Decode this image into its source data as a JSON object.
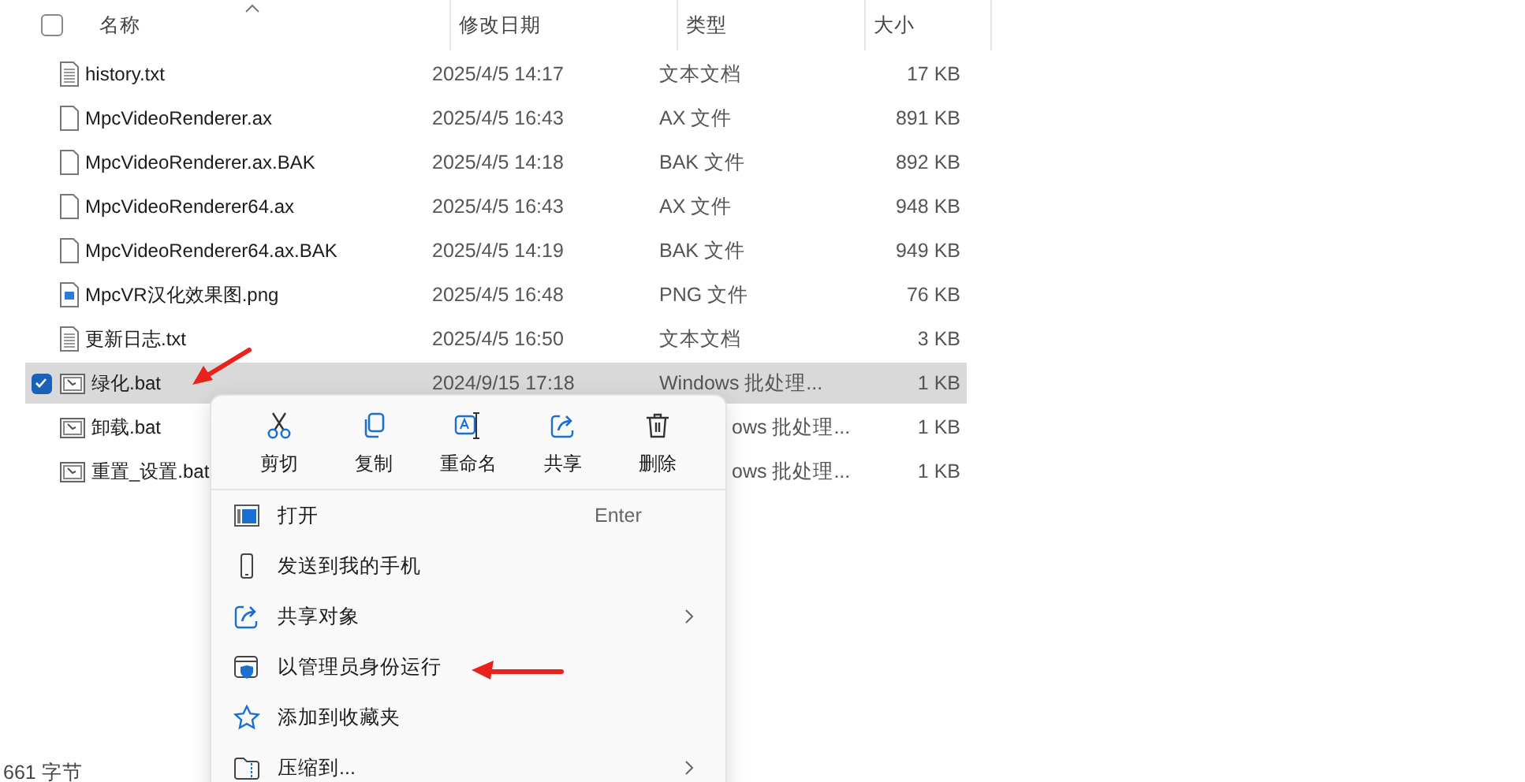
{
  "columns": [
    {
      "label": "名称",
      "sorted": true
    },
    {
      "label": "修改日期",
      "sorted": false
    },
    {
      "label": "类型",
      "sorted": false
    },
    {
      "label": "大小",
      "sorted": false
    }
  ],
  "select_all": {
    "checked": false
  },
  "files": [
    {
      "name": "history.txt",
      "date": "2025/4/5 14:17",
      "type": "文本文档",
      "size": "17 KB",
      "kind": "text",
      "selected": false
    },
    {
      "name": "MpcVideoRenderer.ax",
      "date": "2025/4/5 16:43",
      "type": "AX 文件",
      "size": "891 KB",
      "kind": "file",
      "selected": false
    },
    {
      "name": "MpcVideoRenderer.ax.BAK",
      "date": "2025/4/5 14:18",
      "type": "BAK 文件",
      "size": "892 KB",
      "kind": "file",
      "selected": false
    },
    {
      "name": "MpcVideoRenderer64.ax",
      "date": "2025/4/5 16:43",
      "type": "AX 文件",
      "size": "948 KB",
      "kind": "file",
      "selected": false
    },
    {
      "name": "MpcVideoRenderer64.ax.BAK",
      "date": "2025/4/5 14:19",
      "type": "BAK 文件",
      "size": "949 KB",
      "kind": "file",
      "selected": false
    },
    {
      "name": "MpcVR汉化效果图.png",
      "date": "2025/4/5 16:48",
      "type": "PNG 文件",
      "size": "76 KB",
      "kind": "image",
      "selected": false
    },
    {
      "name": "更新日志.txt",
      "date": "2025/4/5 16:50",
      "type": "文本文档",
      "size": "3 KB",
      "kind": "text",
      "selected": false
    },
    {
      "name": "绿化.bat",
      "date": "2024/9/15 17:18",
      "type": "Windows 批处理...",
      "size": "1 KB",
      "kind": "batch",
      "selected": true
    },
    {
      "name": "卸载.bat",
      "type": "ows 批处理...",
      "size": "1 KB",
      "kind": "batch",
      "selected": false
    },
    {
      "name": "重置_设置.bat",
      "type": "ows 批处理...",
      "size": "1 KB",
      "kind": "batch",
      "selected": false
    }
  ],
  "context_menu": {
    "actions": [
      "剪切",
      "复制",
      "重命名",
      "共享",
      "删除"
    ],
    "items": [
      {
        "label": "打开",
        "shortcut": "Enter"
      },
      {
        "label": "发送到我的手机"
      },
      {
        "label": "共享对象",
        "submenu": true
      },
      {
        "label": "以管理员身份运行"
      },
      {
        "label": "添加到收藏夹"
      },
      {
        "label": "压缩到...",
        "submenu": true
      }
    ]
  },
  "status_bar": {
    "text": "661 字节"
  }
}
